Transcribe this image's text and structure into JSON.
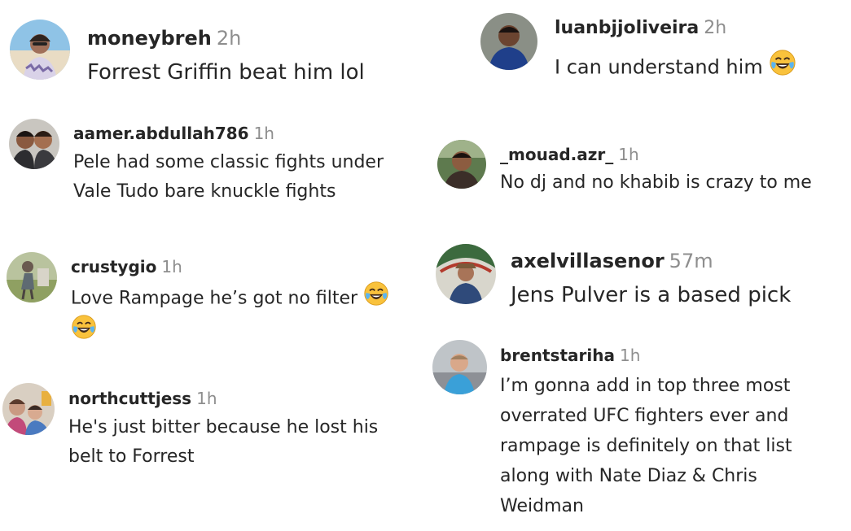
{
  "comments": [
    {
      "username": "moneybreh",
      "time": "2h",
      "lines": [
        "Forrest Griffin beat him lol"
      ]
    },
    {
      "username": "luanbjjoliveira",
      "time": "2h",
      "lines": [
        "I can understand him"
      ],
      "emoji": "face-with-tears-of-joy"
    },
    {
      "username": "aamer.abdullah786",
      "time": "1h",
      "lines": [
        "Pele had some classic fights under",
        "Vale Tudo bare knuckle fights"
      ]
    },
    {
      "username": "_mouad.azr_",
      "time": "1h",
      "lines": [
        "No dj and no khabib is crazy to me"
      ]
    },
    {
      "username": "crustygio",
      "time": "1h",
      "lines": [
        "Love Rampage he’s got no filter"
      ],
      "emoji": "face-with-tears-of-joy"
    },
    {
      "username": "axelvillasenor",
      "time": "57m",
      "lines": [
        "Jens Pulver is a based pick"
      ]
    },
    {
      "username": "brentstariha",
      "time": "1h",
      "lines": [
        "I’m gonna add in top three most",
        "overrated UFC fighters ever and",
        "rampage is definitely on that list",
        "along with Nate Diaz & Chris",
        "Weidman"
      ]
    },
    {
      "username": "northcuttjess",
      "time": "1h",
      "lines": [
        "He's just bitter because he lost his",
        "belt to Forrest"
      ]
    }
  ],
  "colors": {
    "username": "#262626",
    "timestamp": "#8e8e8e",
    "text": "#262626",
    "emoji_face": "#f9c23c"
  }
}
